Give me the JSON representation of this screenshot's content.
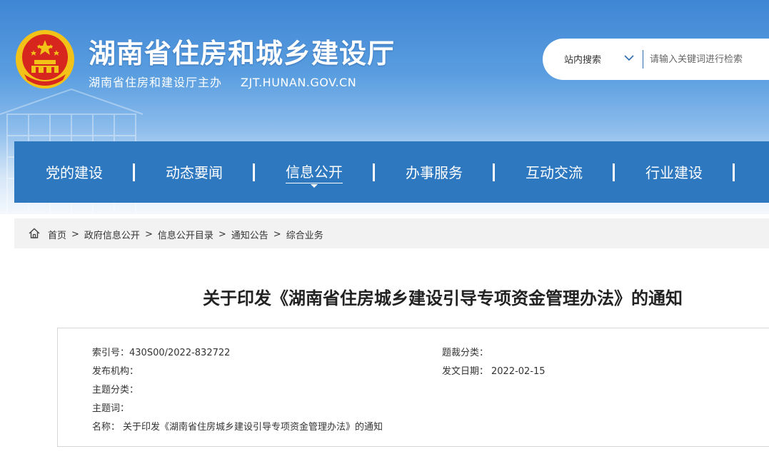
{
  "header": {
    "site_title": "湖南省住房和城乡建设厅",
    "sponsor": "湖南省住房和建设厅主办",
    "domain": "ZJT.HUNAN.GOV.CN"
  },
  "search": {
    "scope": "站内搜索",
    "placeholder": "请输入关键词进行检索"
  },
  "nav": {
    "items": [
      {
        "label": "党的建设"
      },
      {
        "label": "动态要闻"
      },
      {
        "label": "信息公开"
      },
      {
        "label": "办事服务"
      },
      {
        "label": "互动交流"
      },
      {
        "label": "行业建设"
      }
    ],
    "active_index": 2
  },
  "breadcrumb": {
    "items": [
      "首页",
      "政府信息公开",
      "信息公开目录",
      "通知公告",
      "综合业务"
    ],
    "separator": ">"
  },
  "article": {
    "title": "关于印发《湖南省住房城乡建设引导专项资金管理办法》的通知",
    "meta": {
      "index_label": "索引号：",
      "index_value": "430S00/2022-832722",
      "genre_label": "题裁分类：",
      "genre_value": "",
      "publisher_label": "发布机构：",
      "publisher_value": "",
      "date_label": "发文日期：",
      "date_value": "2022-02-15",
      "topic_label": "主题分类：",
      "topic_value": "",
      "keywords_label": "主题词：",
      "keywords_value": "",
      "name_label": "名称：",
      "name_value": "关于印发《湖南省住房城乡建设引导专项资金管理办法》的通知"
    }
  },
  "colors": {
    "nav_bg": "#2e78c0",
    "banner_top": "#3f86d4",
    "emblem_red": "#d7261e",
    "emblem_gold": "#f3c218"
  },
  "icons": {
    "emblem": "national-emblem-icon",
    "home": "home-icon",
    "dropdown": "chevron-down-icon"
  }
}
